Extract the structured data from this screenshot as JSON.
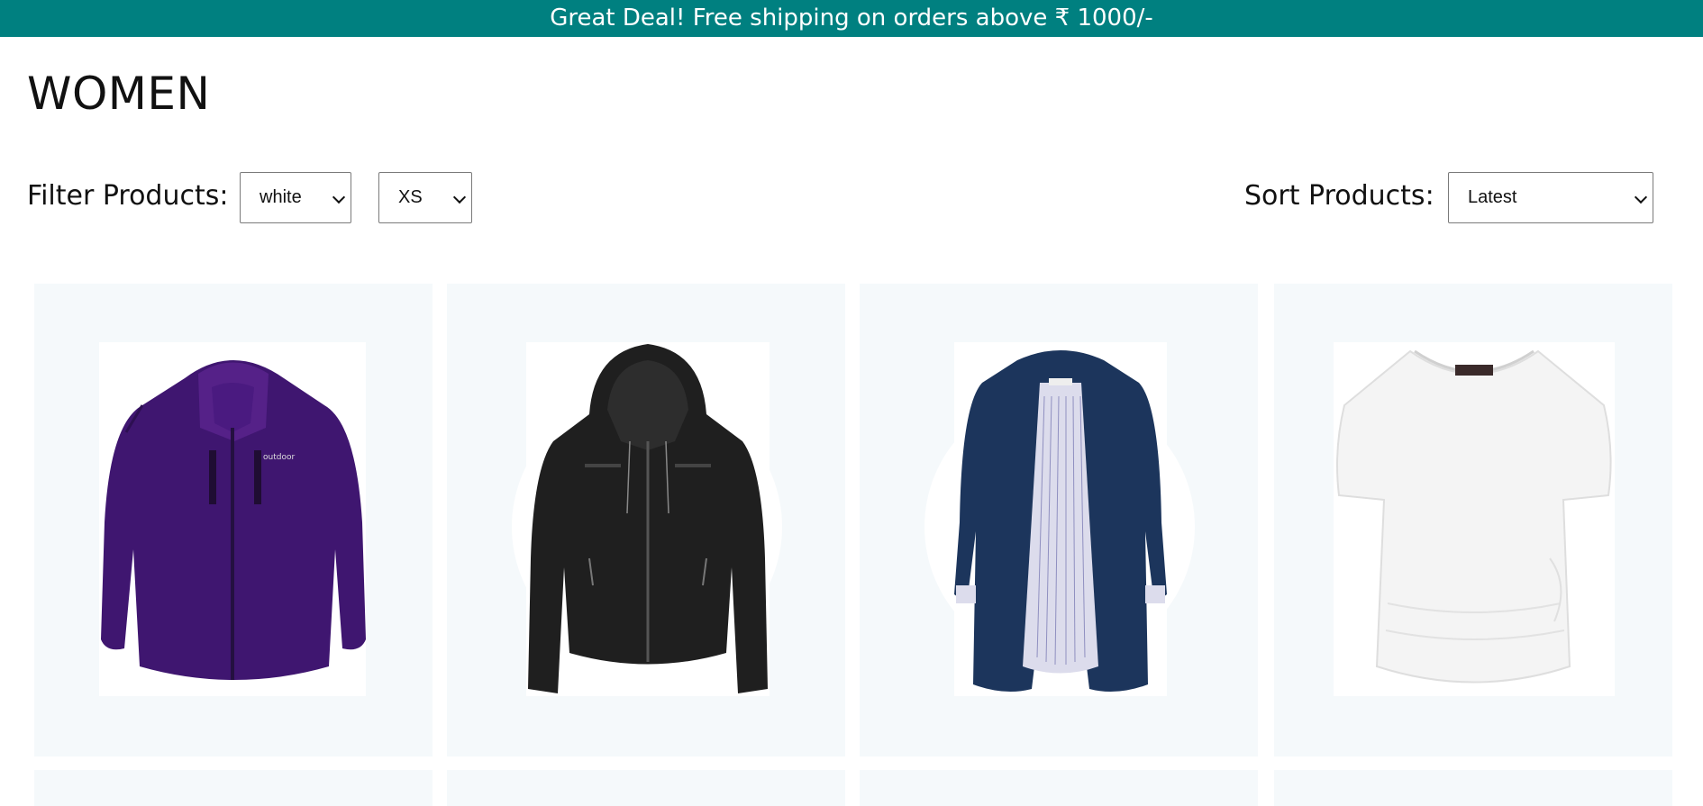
{
  "announcement": {
    "text": "Great Deal! Free shipping on orders above ₹ 1000/-"
  },
  "page": {
    "title": "WOMEN"
  },
  "filters": {
    "label": "Filter Products:",
    "color": {
      "selected": "white"
    },
    "size": {
      "selected": "XS"
    }
  },
  "sort": {
    "label": "Sort Products:",
    "selected": "Latest"
  },
  "colors": {
    "announcement_bg": "#008080",
    "card_bg": "#f5f9fb"
  },
  "products": [
    {
      "image": "purple-outdoor-jacket",
      "logo_text": "outdoor"
    },
    {
      "image": "black-leather-hooded-jacket"
    },
    {
      "image": "navy-trench-coat"
    },
    {
      "image": "white-draped-tshirt"
    }
  ]
}
